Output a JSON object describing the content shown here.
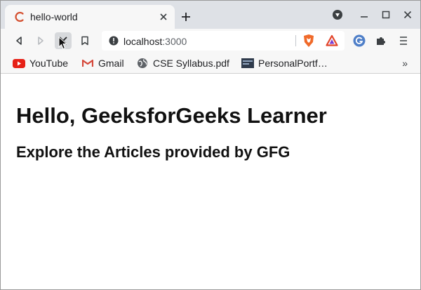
{
  "tab": {
    "title": "hello-world",
    "favicon": "react-loading-icon",
    "close": "close-icon"
  },
  "window_controls": [
    "media-icon",
    "minimize-icon",
    "maximize-icon",
    "close-icon"
  ],
  "toolbar": {
    "buttons": [
      "back-icon",
      "forward-icon",
      "stop-icon",
      "bookmark-icon"
    ],
    "url_host": "localhost",
    "url_port": ":3000",
    "extensions": [
      "brave-shield-icon",
      "brave-rewards-icon",
      "grammarly-icon",
      "puzzle-icon",
      "menu-icon"
    ]
  },
  "bookmarks": {
    "items": [
      {
        "label": "YouTube",
        "icon": "youtube-icon"
      },
      {
        "label": "Gmail",
        "icon": "gmail-icon"
      },
      {
        "label": "CSE Syllabus.pdf",
        "icon": "globe-icon"
      },
      {
        "label": "PersonalPortf…",
        "icon": "portfolio-icon"
      }
    ],
    "more": "»"
  },
  "page": {
    "heading": "Hello, GeeksforGeeks Learner",
    "subheading": "Explore the Articles provided by GFG"
  },
  "colors": {
    "tabstrip": "#dee1e6",
    "toolbar": "#f7f7f7",
    "favicon": "#d44f2f",
    "youtube": "#e62117",
    "brave": "#f06a2a"
  }
}
